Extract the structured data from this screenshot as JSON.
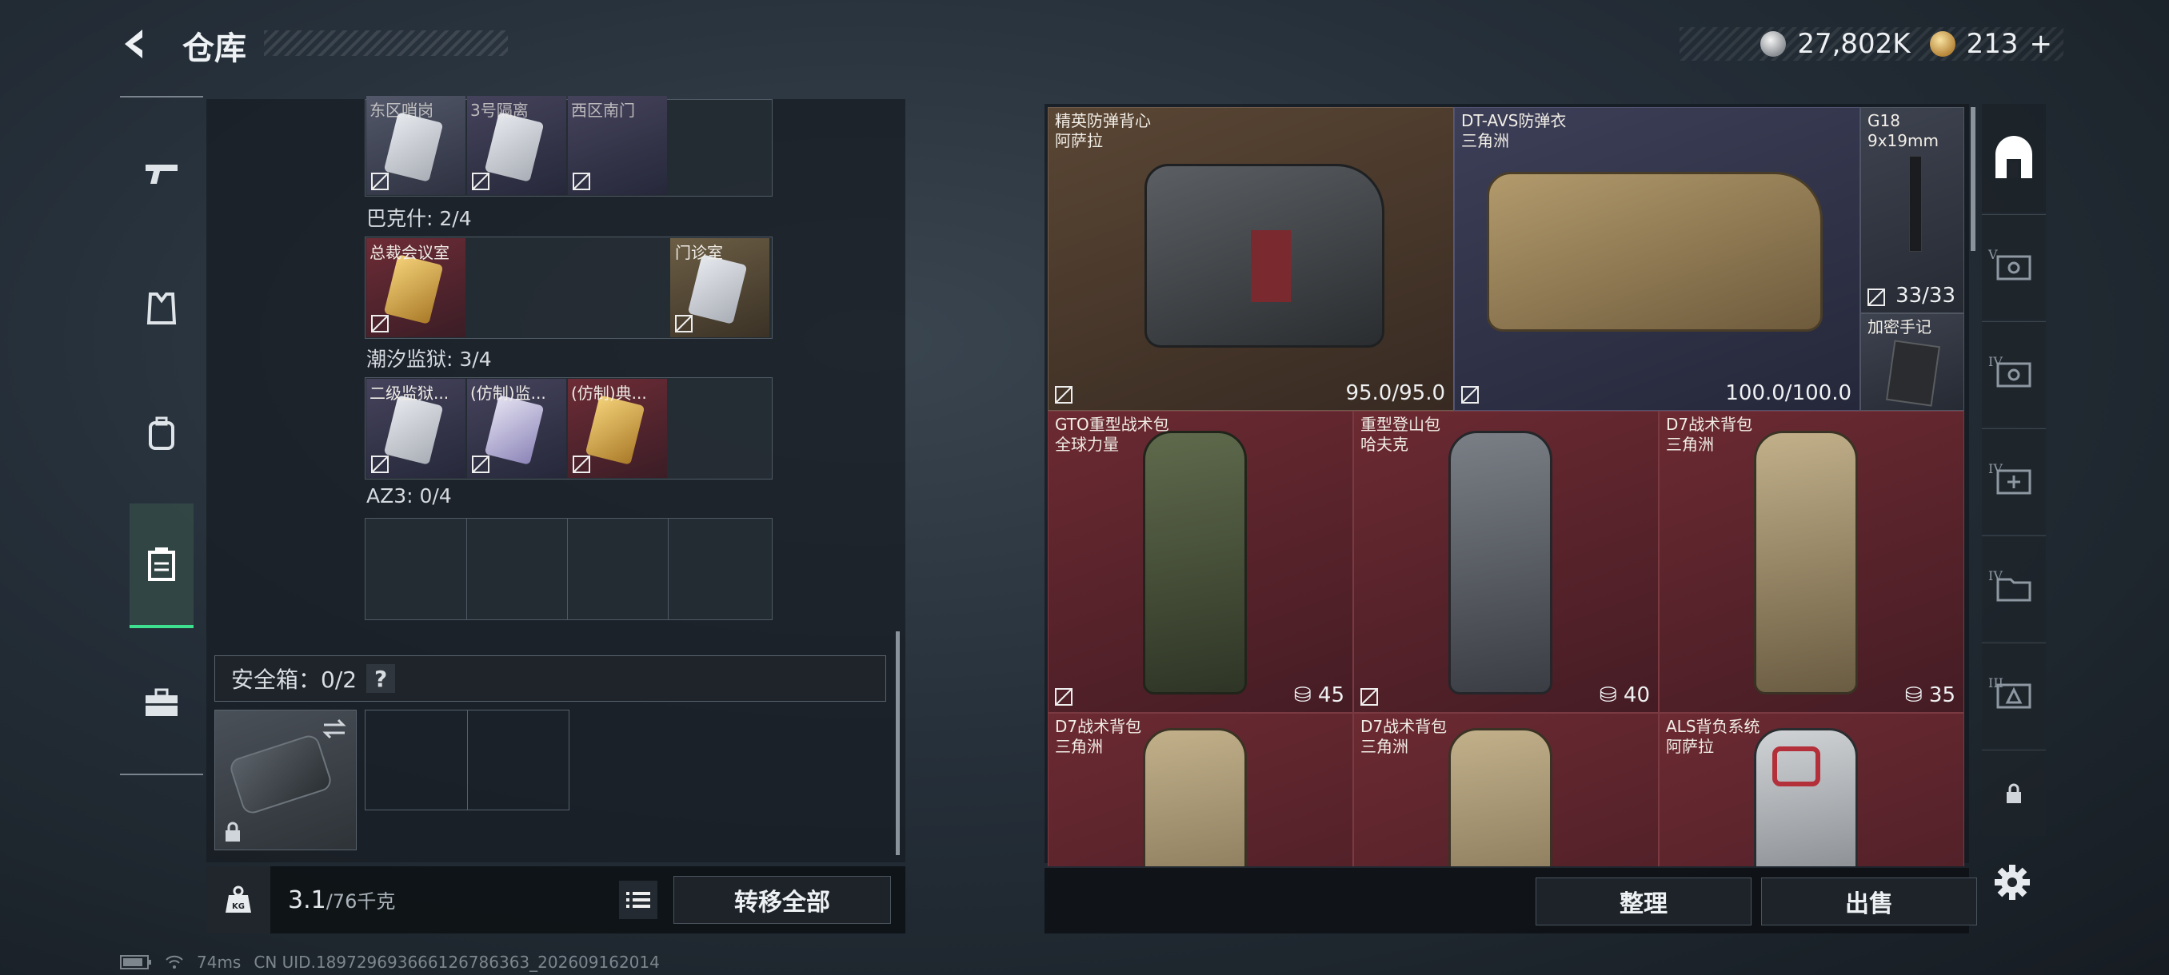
{
  "header": {
    "title": "仓库"
  },
  "currency": {
    "silver": "27,802K",
    "gold": "213",
    "gold_add": "+"
  },
  "left_nav": [
    "weapons-icon",
    "armor-icon",
    "backpack-icon",
    "container-icon",
    "case-icon"
  ],
  "keys": {
    "row1": [
      "东区哨岗",
      "3号隔离",
      "西区南门"
    ],
    "bakesh_label": "巴克什: 2/4",
    "bakesh": [
      "总裁会议室",
      "门诊室"
    ],
    "chaoxi_label": "潮汐监狱: 3/4",
    "chaoxi": [
      "二级监狱...",
      "(仿制)监...",
      "(仿制)典..."
    ],
    "az3_label": "AZ3: 0/4"
  },
  "safe_box": {
    "label": "安全箱：0/2",
    "help": "?"
  },
  "weight": {
    "current": "3.1",
    "max": "/76千克"
  },
  "left_footer": {
    "transfer_all": "转移全部"
  },
  "items": [
    {
      "name": "精英防弹背心",
      "sub": "阿萨拉",
      "value": "95.0/95.0"
    },
    {
      "name": "DT-AVS防弹衣",
      "sub": "三角洲",
      "value": "100.0/100.0"
    },
    {
      "name": "G18",
      "sub": "9x19mm",
      "value": "33/33"
    },
    {
      "name": "加密手记",
      "sub": "",
      "value": ""
    },
    {
      "name": "GTO重型战术包",
      "sub": "全球力量",
      "value": "45"
    },
    {
      "name": "重型登山包",
      "sub": "哈夫克",
      "value": "40"
    },
    {
      "name": "D7战术背包",
      "sub": "三角洲",
      "value": "35"
    },
    {
      "name": "D7战术背包",
      "sub": "三角洲",
      "value": ""
    },
    {
      "name": "D7战术背包",
      "sub": "三角洲",
      "value": ""
    },
    {
      "name": "ALS背负系统",
      "sub": "阿萨拉",
      "value": ""
    }
  ],
  "right_footer": {
    "sort": "整理",
    "sell": "出售"
  },
  "filter_levels": [
    "V",
    "IV",
    "IV",
    "IV",
    "III"
  ],
  "status": {
    "ping": "74ms",
    "uid": "CN UID.189729693666126786363_202609162014"
  }
}
